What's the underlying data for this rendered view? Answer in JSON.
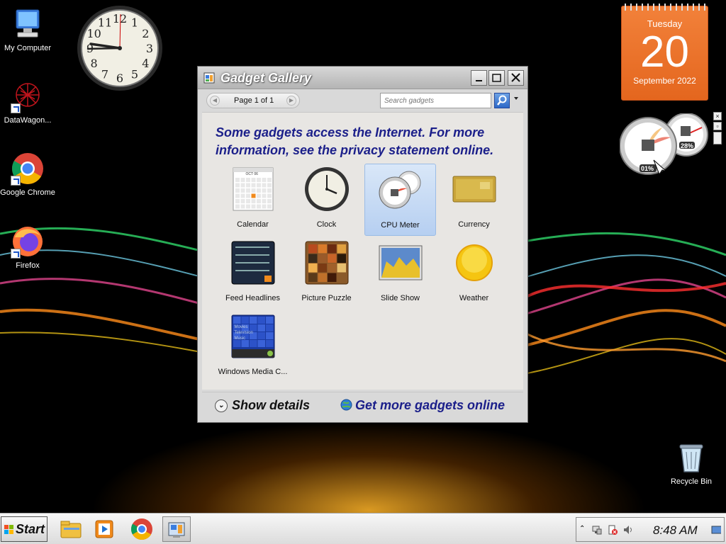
{
  "desktop": {
    "icons": [
      {
        "label": "My Computer"
      },
      {
        "label": "DataWagon..."
      },
      {
        "label": "Google Chrome"
      },
      {
        "label": "Firefox"
      }
    ],
    "recycle_bin_label": "Recycle Bin"
  },
  "clock_gadget": {
    "numerals": [
      "12",
      "1",
      "2",
      "3",
      "4",
      "5",
      "6",
      "7",
      "8",
      "9",
      "10",
      "11"
    ]
  },
  "calendar_gadget": {
    "day": "Tuesday",
    "date": "20",
    "month_year": "September 2022"
  },
  "cpu_gadget": {
    "cpu_percent": "01%",
    "memory_percent": "28%"
  },
  "gallery": {
    "title": "Gadget Gallery",
    "page_label": "Page 1 of 1",
    "search_placeholder": "Search gadgets",
    "notice": "Some gadgets access the Internet.  For more information, see the privacy statement online.",
    "gadgets": [
      {
        "label": "Calendar"
      },
      {
        "label": "Clock"
      },
      {
        "label": "CPU Meter"
      },
      {
        "label": "Currency"
      },
      {
        "label": "Feed Headlines"
      },
      {
        "label": "Picture Puzzle"
      },
      {
        "label": "Slide Show"
      },
      {
        "label": "Weather"
      },
      {
        "label": "Windows Media C..."
      }
    ],
    "selected_gadget": "CPU Meter",
    "calendar_thumb_month": "OCT 06",
    "wmc_lines": [
      "Movies",
      "Television",
      "Music"
    ],
    "show_details": "Show details",
    "more_online": "Get more gadgets online"
  },
  "taskbar": {
    "start_label": "Start",
    "clock": "8:48 AM"
  }
}
